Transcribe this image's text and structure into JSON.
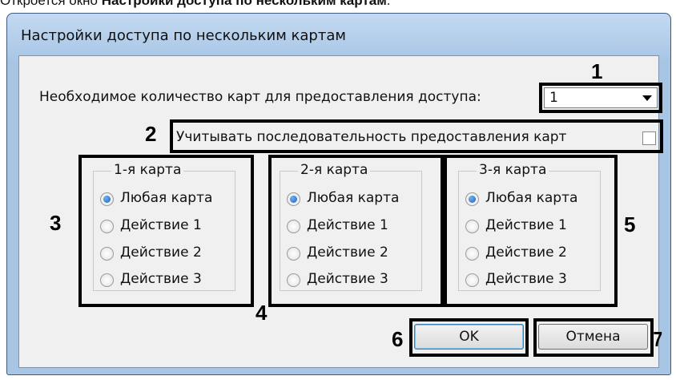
{
  "caption": {
    "prefix": "Откроется окно ",
    "bold": "Настройки доступа по нескольким картам",
    "suffix": "."
  },
  "window": {
    "title": "Настройки доступа по нескольким картам"
  },
  "cards_count": {
    "label": "Необходимое количество карт для предоставления доступа:",
    "value": "1"
  },
  "sequence": {
    "label": "Учитывать последовательность предоставления карт",
    "checked": false
  },
  "groups": [
    {
      "title": "1-я карта",
      "options": [
        "Любая карта",
        "Действие 1",
        "Действие 2",
        "Действие 3"
      ],
      "selected": 0
    },
    {
      "title": "2-я карта",
      "options": [
        "Любая карта",
        "Действие 1",
        "Действие 2",
        "Действие 3"
      ],
      "selected": 0
    },
    {
      "title": "3-я карта",
      "options": [
        "Любая карта",
        "Действие 1",
        "Действие 2",
        "Действие 3"
      ],
      "selected": 0
    }
  ],
  "buttons": {
    "ok": "OK",
    "cancel": "Отмена"
  },
  "callouts": [
    "1",
    "2",
    "3",
    "4",
    "5",
    "6",
    "7"
  ],
  "colors": {
    "titlebar": "#a9c5e4",
    "client_bg": "#f0f0f0",
    "highlight": "#000000",
    "radio_selected": "#1b5fb8"
  }
}
